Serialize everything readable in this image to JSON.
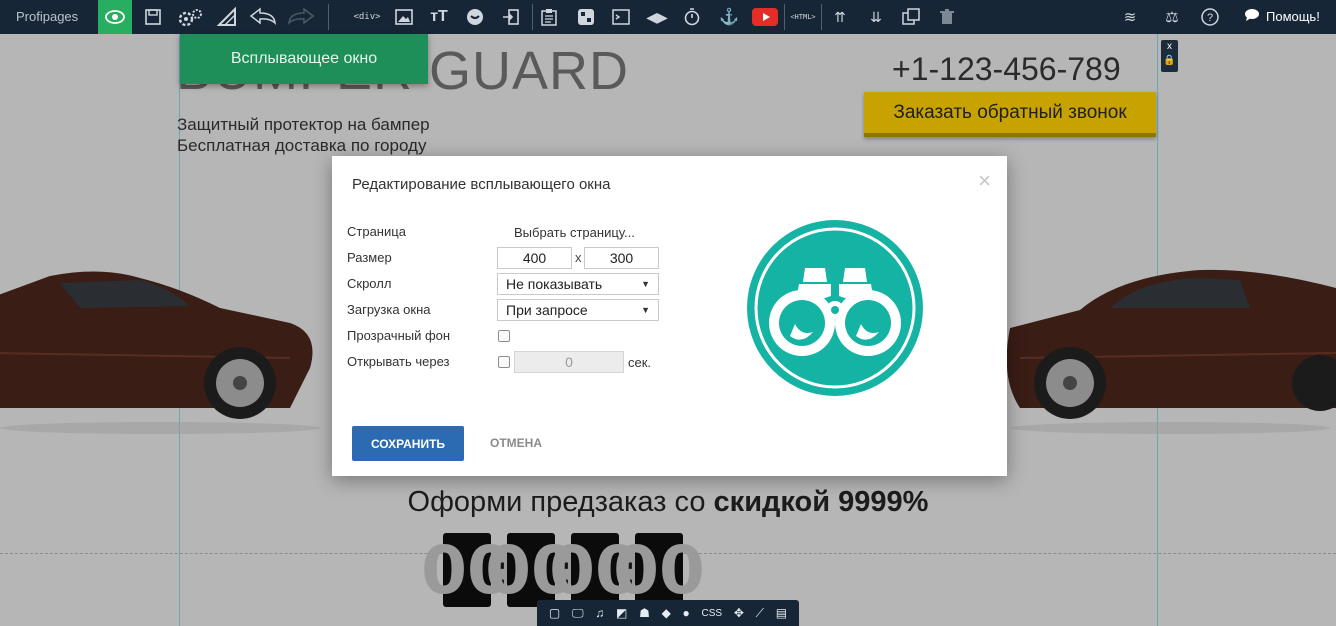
{
  "toolbar": {
    "brand": "Profipages",
    "div_label": "<div>",
    "html_label": "<HTML>",
    "help": "Помощь!"
  },
  "page": {
    "logo_text": "BUMPER GUARD",
    "tagline_1": "Защитный протектор на бампер",
    "tagline_2": "Бесплатная доставка по городу",
    "phone": "+1-123-456-789",
    "callback_button": "Заказать обратный звонок",
    "popup_tag": "Всплывающее окно",
    "corner_close": "x",
    "promo_prefix": "Оформи предзаказ со ",
    "promo_bold": "скидкой 9999%",
    "timer": [
      "00",
      "00",
      "00",
      "00"
    ],
    "timer_separator": ":"
  },
  "bottom_bar": {
    "css_label": "CSS"
  },
  "modal": {
    "title": "Редактирование всплывающего окна",
    "close": "×",
    "fields": {
      "page_label": "Страница",
      "page_value": "Выбрать страницу...",
      "size_label": "Размер",
      "width": "400",
      "size_sep": "x",
      "height": "300",
      "scroll_label": "Скролл",
      "scroll_value": "Не показывать",
      "load_label": "Загрузка окна",
      "load_value": "При запросе",
      "transparent_label": "Прозрачный фон",
      "open_after_label": "Открывать через",
      "open_after_value": "0",
      "seconds": "сек."
    },
    "save_button": "СОХРАНИТЬ",
    "cancel_button": "ОТМЕНА"
  },
  "colors": {
    "toolbar_bg": "#172636",
    "active_green": "#27ae60",
    "popup_tag_green": "#1f8f5a",
    "callback_gold": "#c8a300",
    "save_blue": "#2c6ab1",
    "emblem_teal": "#15b3a4",
    "overlay": "#b6b6b6"
  },
  "icons": [
    "eye-icon",
    "save-icon",
    "gear-icon",
    "ruler-icon",
    "undo-icon",
    "redo-icon",
    "div-icon",
    "image-icon",
    "text-size-icon",
    "button-icon",
    "exit-icon",
    "clipboard-icon",
    "form-icon",
    "terminal-icon",
    "code-icon",
    "timer-icon",
    "anchor-icon",
    "youtube-icon",
    "html-icon",
    "sort-up-icon",
    "sort-down-icon",
    "copy-icon",
    "trash-icon",
    "layers-icon",
    "scales-icon",
    "help-icon",
    "chat-icon"
  ]
}
